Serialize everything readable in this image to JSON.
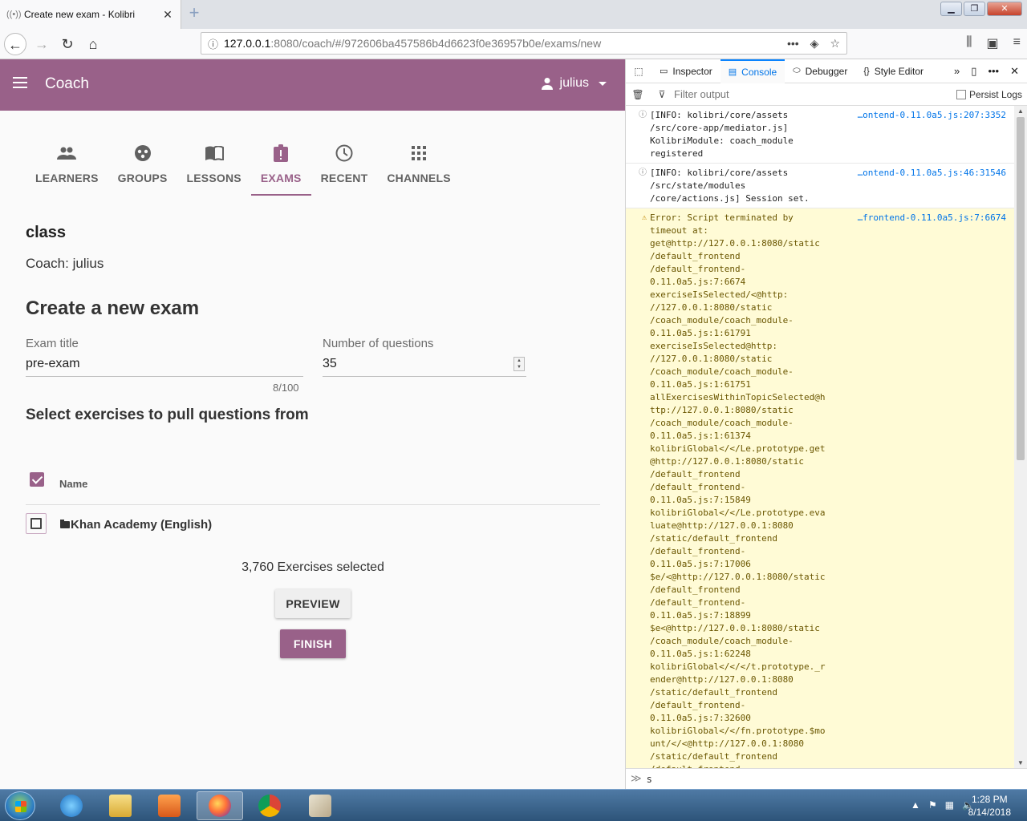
{
  "browser": {
    "tab_title": "Create new exam - Kolibri",
    "url_host": "127.0.0.1",
    "url_rest": ":8080/coach/#/972606ba457586b4d6623f0e36957b0e/exams/new",
    "url_more": "•••"
  },
  "app": {
    "title": "Coach",
    "user": "julius",
    "accent": "#996189",
    "tabs": [
      {
        "label": "LEARNERS",
        "icon": "people-icon"
      },
      {
        "label": "GROUPS",
        "icon": "groups-icon"
      },
      {
        "label": "LESSONS",
        "icon": "book-icon"
      },
      {
        "label": "EXAMS",
        "icon": "assignment-icon",
        "active": true
      },
      {
        "label": "RECENT",
        "icon": "clock-icon"
      },
      {
        "label": "CHANNELS",
        "icon": "apps-grid-icon"
      }
    ],
    "class_name": "class",
    "coach_line": "Coach: julius",
    "heading": "Create a new exam",
    "exam_title_label": "Exam title",
    "exam_title_value": "pre-exam",
    "exam_title_counter": "8/100",
    "num_questions_label": "Number of questions",
    "num_questions_value": "35",
    "select_heading": "Select exercises to pull questions from",
    "table_header_name": "Name",
    "rows": [
      {
        "name": "Khan Academy (English)",
        "checked": false
      }
    ],
    "summary": "3,760 Exercises selected",
    "preview_label": "PREVIEW",
    "finish_label": "FINISH"
  },
  "devtools": {
    "tabs": [
      "Inspector",
      "Console",
      "Debugger",
      "Style Editor"
    ],
    "active_tab": "Console",
    "filter_placeholder": "Filter output",
    "persist_logs": "Persist Logs",
    "messages": [
      {
        "level": "info",
        "text": "[INFO: kolibri/core/assets\n/src/core-app/mediator.js]\nKolibriModule: coach_module\nregistered",
        "source": "…ontend-0.11.0a5.js:207:3352"
      },
      {
        "level": "info",
        "text": "[INFO: kolibri/core/assets\n/src/state/modules\n/core/actions.js] Session set.",
        "source": "…ontend-0.11.0a5.js:46:31546"
      },
      {
        "level": "warn",
        "text": "Error: Script terminated by\ntimeout at:\nget@http://127.0.0.1:8080/static\n/default_frontend\n/default_frontend-\n0.11.0a5.js:7:6674\nexerciseIsSelected/<@http:\n//127.0.0.1:8080/static\n/coach_module/coach_module-\n0.11.0a5.js:1:61791\nexerciseIsSelected@http:\n//127.0.0.1:8080/static\n/coach_module/coach_module-\n0.11.0a5.js:1:61751\nallExercisesWithinTopicSelected@h\nttp://127.0.0.1:8080/static\n/coach_module/coach_module-\n0.11.0a5.js:1:61374\nkolibriGlobal</</Le.prototype.get\n@http://127.0.0.1:8080/static\n/default_frontend\n/default_frontend-\n0.11.0a5.js:7:15849\nkolibriGlobal</</Le.prototype.eva\nluate@http://127.0.0.1:8080\n/static/default_frontend\n/default_frontend-\n0.11.0a5.js:7:17006\n$e/<@http://127.0.0.1:8080/static\n/default_frontend\n/default_frontend-\n0.11.0a5.js:7:18899\n$e<@http://127.0.0.1:8080/static\n/coach_module/coach_module-\n0.11.0a5.js:1:62248\nkolibriGlobal</</</t.prototype._r\nender@http://127.0.0.1:8080\n/static/default_frontend\n/default_frontend-\n0.11.0a5.js:7:32600\nkolibriGlobal</</fn.prototype.$mo\nunt/</<@http://127.0.0.1:8080\n/static/default_frontend\n/default_frontend-",
        "source": "…frontend-0.11.0a5.js:7:6674"
      }
    ],
    "input_value": "s"
  },
  "taskbar": {
    "time": "1:28 PM",
    "date": "8/14/2018"
  }
}
